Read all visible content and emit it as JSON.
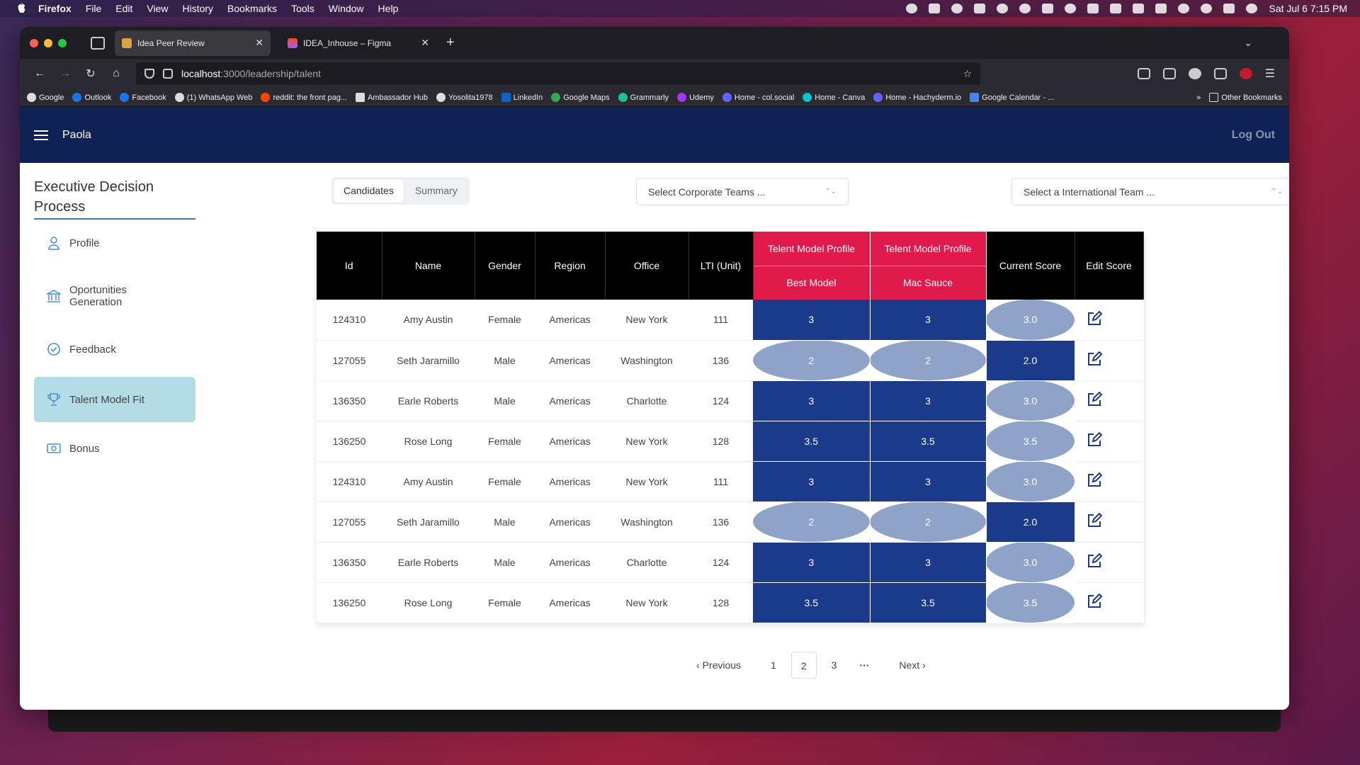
{
  "menubar": {
    "app": "Firefox",
    "items": [
      "File",
      "Edit",
      "View",
      "History",
      "Bookmarks",
      "Tools",
      "Window",
      "Help"
    ],
    "clock": "Sat Jul 6  7:15 PM"
  },
  "browser": {
    "tabs": [
      {
        "title": "Idea Peer Review",
        "active": true
      },
      {
        "title": "IDEA_Inhouse – Figma",
        "active": false
      }
    ],
    "url_host": "localhost",
    "url_path": ":3000/leadership/talent",
    "bookmarks": [
      "Google",
      "Outlook",
      "Facebook",
      "(1) WhatsApp Web",
      "reddit: the front pag...",
      "Ambassador Hub",
      "Yosolita1978",
      "LinkedIn",
      "Google Maps",
      "Grammarly",
      "Udemy",
      "Home - col.social",
      "Home - Canva",
      "Home - Hachyderm.io",
      "Google Calendar - ..."
    ],
    "other_bookmarks": "Other Bookmarks"
  },
  "app": {
    "username": "Paola",
    "logout": "Log Out",
    "sidebar": {
      "title_line1": "Executive Decision",
      "title_line2": "Process",
      "items": [
        {
          "label": "Profile",
          "icon": "user-icon"
        },
        {
          "label": "Oportunities",
          "label2": "Generation",
          "icon": "bank-icon"
        },
        {
          "label": "Feedback",
          "icon": "check-circle-icon"
        },
        {
          "label": "Talent Model Fit",
          "icon": "trophy-icon",
          "active": true
        },
        {
          "label": "Bonus",
          "icon": "money-icon"
        }
      ]
    },
    "tabs": [
      "Candidates",
      "Summary"
    ],
    "corporate_select": "Select Corporate Teams ...",
    "international_select": "Select a International Team ...",
    "table": {
      "headers": {
        "id": "Id",
        "name": "Name",
        "gender": "Gender",
        "region": "Region",
        "office": "Office",
        "lti": "LTI (Unit)",
        "tmp1_top": "Telent Model Profile",
        "tmp1_bottom": "Best Model",
        "tmp2_top": "Telent Model Profile",
        "tmp2_bottom": "Mac Sauce",
        "current": "Current Score",
        "edit": "Edit Score"
      },
      "rows": [
        {
          "id": "124310",
          "name": "Amy Austin",
          "gender": "Female",
          "region": "Americas",
          "office": "New York",
          "lti": "111",
          "best": "3",
          "mac": "3",
          "current": "3.0"
        },
        {
          "id": "127055",
          "name": "Seth Jaramillo",
          "gender": "Male",
          "region": "Americas",
          "office": "Washington",
          "lti": "136",
          "best": "2",
          "mac": "2",
          "current": "2.0"
        },
        {
          "id": "136350",
          "name": "Earle Roberts",
          "gender": "Male",
          "region": "Americas",
          "office": "Charlotte",
          "lti": "124",
          "best": "3",
          "mac": "3",
          "current": "3.0"
        },
        {
          "id": "136250",
          "name": "Rose Long",
          "gender": "Female",
          "region": "Americas",
          "office": "New York",
          "lti": "128",
          "best": "3.5",
          "mac": "3.5",
          "current": "3.5"
        },
        {
          "id": "124310",
          "name": "Amy Austin",
          "gender": "Female",
          "region": "Americas",
          "office": "New York",
          "lti": "111",
          "best": "3",
          "mac": "3",
          "current": "3.0"
        },
        {
          "id": "127055",
          "name": "Seth Jaramillo",
          "gender": "Male",
          "region": "Americas",
          "office": "Washington",
          "lti": "136",
          "best": "2",
          "mac": "2",
          "current": "2.0"
        },
        {
          "id": "136350",
          "name": "Earle Roberts",
          "gender": "Male",
          "region": "Americas",
          "office": "Charlotte",
          "lti": "124",
          "best": "3",
          "mac": "3",
          "current": "3.0"
        },
        {
          "id": "136250",
          "name": "Rose Long",
          "gender": "Female",
          "region": "Americas",
          "office": "New York",
          "lti": "128",
          "best": "3.5",
          "mac": "3.5",
          "current": "3.5"
        }
      ]
    },
    "pager": {
      "previous": "Previous",
      "pages": [
        "1",
        "2",
        "3"
      ],
      "ellipsis": "···",
      "next": "Next",
      "current": "2"
    }
  }
}
